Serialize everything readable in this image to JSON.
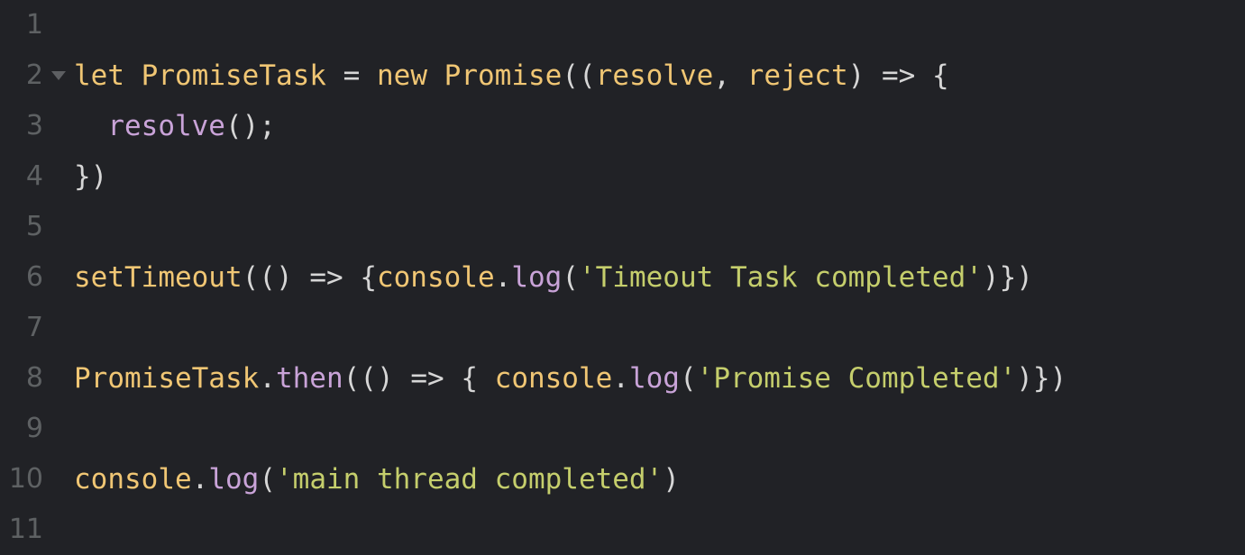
{
  "editor": {
    "background": "#212226",
    "gutter_color": "#5e6163",
    "colors": {
      "identifier": "#f0c674",
      "keyword": "#f0c674",
      "method": "#c9a3d8",
      "string": "#c5ce6c",
      "punctuation": "#d6d6d6",
      "fold_arrow": "#5d5f62"
    },
    "language": "javascript",
    "lines": [
      {
        "number": "1",
        "fold": false,
        "tokens": []
      },
      {
        "number": "2",
        "fold": true,
        "tokens": [
          {
            "text": "let",
            "kind": "keyword"
          },
          {
            "text": " ",
            "kind": "plain"
          },
          {
            "text": "PromiseTask",
            "kind": "ident"
          },
          {
            "text": " ",
            "kind": "plain"
          },
          {
            "text": "=",
            "kind": "punct"
          },
          {
            "text": " ",
            "kind": "plain"
          },
          {
            "text": "new",
            "kind": "keyword"
          },
          {
            "text": " ",
            "kind": "plain"
          },
          {
            "text": "Promise",
            "kind": "ident"
          },
          {
            "text": "((",
            "kind": "punct"
          },
          {
            "text": "resolve",
            "kind": "ident"
          },
          {
            "text": ",",
            "kind": "punct"
          },
          {
            "text": " ",
            "kind": "plain"
          },
          {
            "text": "reject",
            "kind": "ident"
          },
          {
            "text": ")",
            "kind": "punct"
          },
          {
            "text": " ",
            "kind": "plain"
          },
          {
            "text": "=>",
            "kind": "punct"
          },
          {
            "text": " ",
            "kind": "plain"
          },
          {
            "text": "{",
            "kind": "punct"
          }
        ]
      },
      {
        "number": "3",
        "fold": false,
        "tokens": [
          {
            "text": "  ",
            "kind": "plain"
          },
          {
            "text": "resolve",
            "kind": "method"
          },
          {
            "text": "();",
            "kind": "punct"
          }
        ]
      },
      {
        "number": "4",
        "fold": false,
        "tokens": [
          {
            "text": "})",
            "kind": "punct"
          }
        ]
      },
      {
        "number": "5",
        "fold": false,
        "tokens": []
      },
      {
        "number": "6",
        "fold": false,
        "tokens": [
          {
            "text": "setTimeout",
            "kind": "ident"
          },
          {
            "text": "(()",
            "kind": "punct"
          },
          {
            "text": " ",
            "kind": "plain"
          },
          {
            "text": "=>",
            "kind": "punct"
          },
          {
            "text": " ",
            "kind": "plain"
          },
          {
            "text": "{",
            "kind": "punct"
          },
          {
            "text": "console",
            "kind": "ident"
          },
          {
            "text": ".",
            "kind": "punct"
          },
          {
            "text": "log",
            "kind": "method"
          },
          {
            "text": "(",
            "kind": "punct"
          },
          {
            "text": "'Timeout Task completed'",
            "kind": "string"
          },
          {
            "text": ")})",
            "kind": "punct"
          }
        ]
      },
      {
        "number": "7",
        "fold": false,
        "tokens": []
      },
      {
        "number": "8",
        "fold": false,
        "tokens": [
          {
            "text": "PromiseTask",
            "kind": "ident"
          },
          {
            "text": ".",
            "kind": "punct"
          },
          {
            "text": "then",
            "kind": "method"
          },
          {
            "text": "(()",
            "kind": "punct"
          },
          {
            "text": " ",
            "kind": "plain"
          },
          {
            "text": "=>",
            "kind": "punct"
          },
          {
            "text": " ",
            "kind": "plain"
          },
          {
            "text": "{",
            "kind": "punct"
          },
          {
            "text": " ",
            "kind": "plain"
          },
          {
            "text": "console",
            "kind": "ident"
          },
          {
            "text": ".",
            "kind": "punct"
          },
          {
            "text": "log",
            "kind": "method"
          },
          {
            "text": "(",
            "kind": "punct"
          },
          {
            "text": "'Promise Completed'",
            "kind": "string"
          },
          {
            "text": ")})",
            "kind": "punct"
          }
        ]
      },
      {
        "number": "9",
        "fold": false,
        "tokens": []
      },
      {
        "number": "10",
        "fold": false,
        "tokens": [
          {
            "text": "console",
            "kind": "ident"
          },
          {
            "text": ".",
            "kind": "punct"
          },
          {
            "text": "log",
            "kind": "method"
          },
          {
            "text": "(",
            "kind": "punct"
          },
          {
            "text": "'main thread completed'",
            "kind": "string"
          },
          {
            "text": ")",
            "kind": "punct"
          }
        ]
      },
      {
        "number": "11",
        "fold": false,
        "tokens": []
      }
    ],
    "plain_text": "\nlet PromiseTask = new Promise((resolve, reject) => {\n  resolve();\n})\n\nsetTimeout(() => {console.log('Timeout Task completed')})\n\nPromiseTask.then(() => { console.log('Promise Completed')})\n\nconsole.log('main thread completed')\n"
  }
}
